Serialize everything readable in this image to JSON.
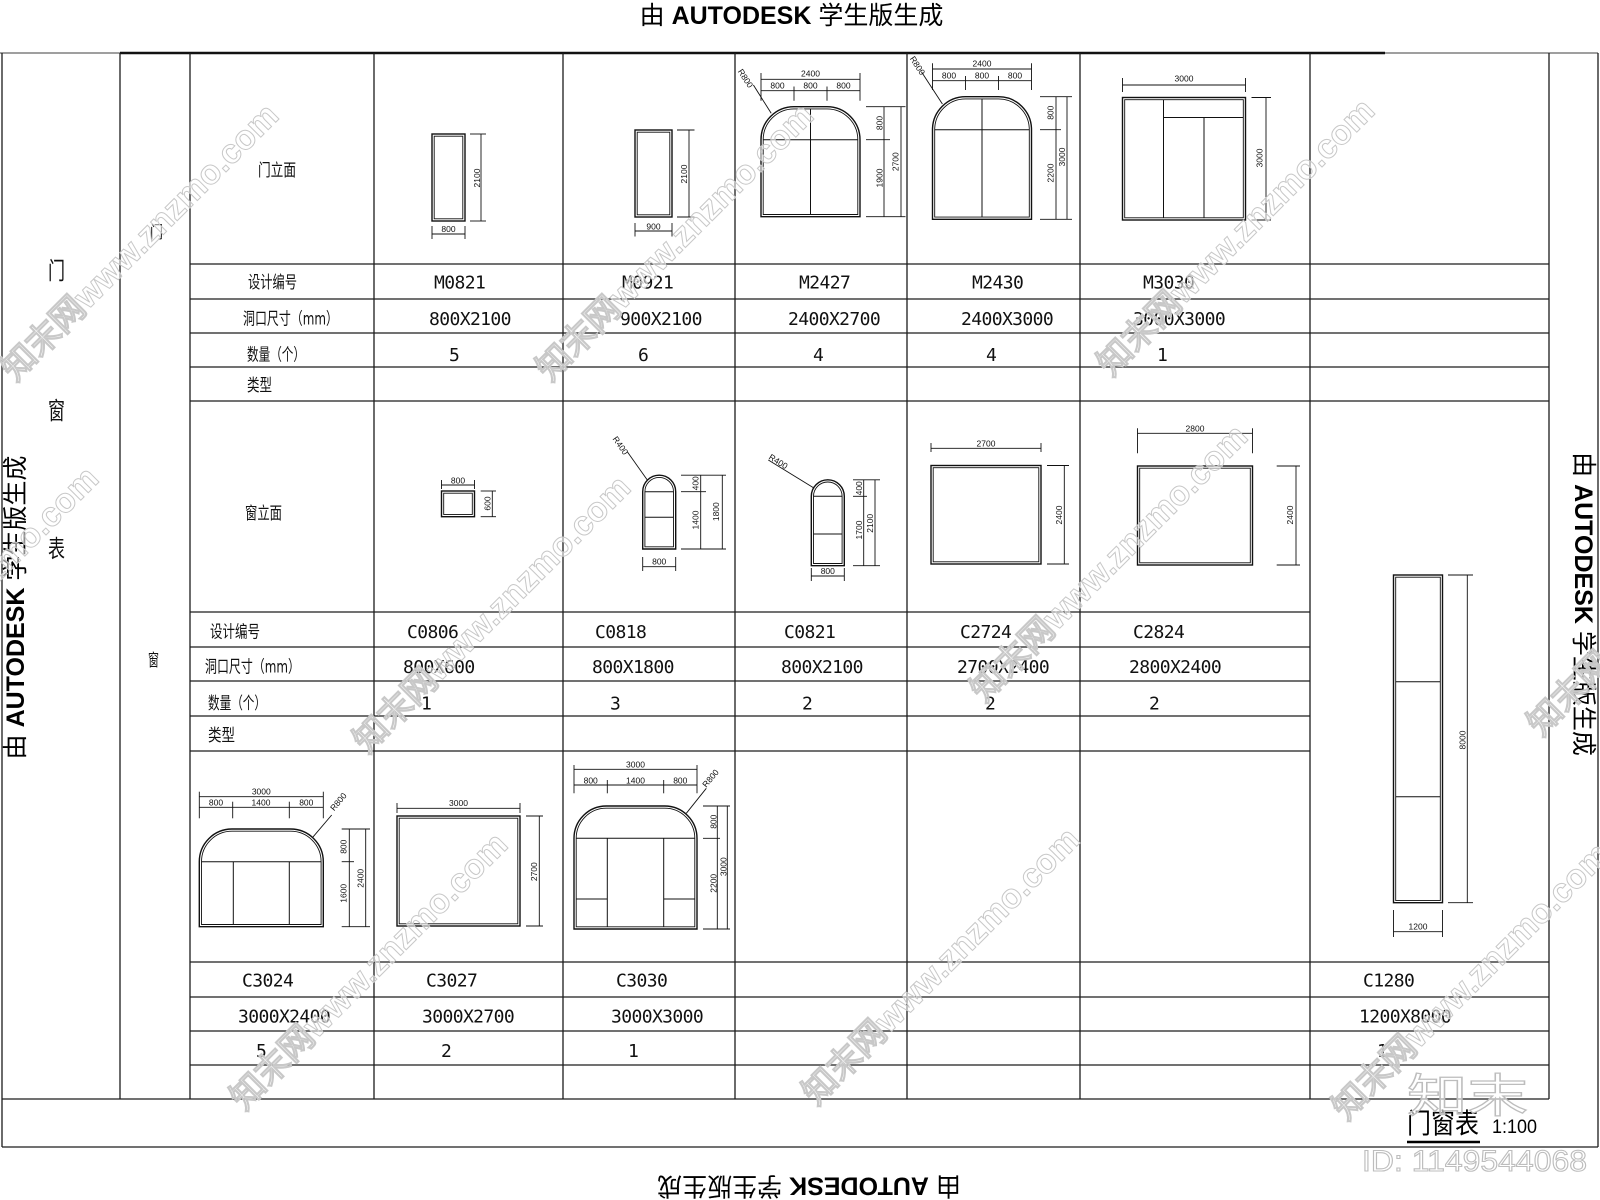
{
  "stamp": {
    "prefix": "由",
    "brand": "AUTODESK",
    "suffix": "学生版生成"
  },
  "sheet": {
    "side_title": [
      "门",
      "窗",
      "表"
    ],
    "section_door": "门",
    "section_window": "窗",
    "title": "门窗表",
    "scale": "1:100"
  },
  "labels": {
    "door_elevation": "门立面",
    "window_elevation": "窗立面",
    "code": "设计编号",
    "size": "洞口尺寸（mm）",
    "quantity": "数量（个）",
    "type": "类型"
  },
  "doors": [
    {
      "code": "M0821",
      "size": "800X2100",
      "quantity": "5",
      "type": "",
      "dims": {
        "width": "800",
        "height": "2100"
      }
    },
    {
      "code": "M0921",
      "size": "900X2100",
      "quantity": "6",
      "type": "",
      "dims": {
        "width": "900",
        "height": "2100"
      }
    },
    {
      "code": "M2427",
      "size": "2400X2700",
      "quantity": "4",
      "type": "",
      "dims": {
        "radius": "R800",
        "total_width": "2400",
        "segments": [
          "800",
          "800",
          "800"
        ],
        "arch_height": "800",
        "lower_height": "1900",
        "total_height": "2700"
      }
    },
    {
      "code": "M2430",
      "size": "2400X3000",
      "quantity": "4",
      "type": "",
      "dims": {
        "radius": "R800",
        "total_width": "2400",
        "segments": [
          "800",
          "800",
          "800"
        ],
        "arch_height": "800",
        "lower_height": "2200",
        "total_height": "3000"
      }
    },
    {
      "code": "M3030",
      "size": "3000X3000",
      "quantity": "1",
      "type": "",
      "dims": {
        "width": "3000",
        "height": "3000"
      }
    }
  ],
  "windows": [
    {
      "code": "C0806",
      "size": "800X600",
      "quantity": "1",
      "type": "",
      "dims": {
        "width": "800",
        "height": "600"
      }
    },
    {
      "code": "C0818",
      "size": "800X1800",
      "quantity": "3",
      "type": "",
      "dims": {
        "radius": "R400",
        "width": "800",
        "arch_height": "400",
        "lower_height": "1400",
        "total_height": "1800"
      }
    },
    {
      "code": "C0821",
      "size": "800X2100",
      "quantity": "2",
      "type": "",
      "dims": {
        "radius": "R400",
        "width": "800",
        "arch_height": "400",
        "lower_height": "1700",
        "total_height": "2100"
      }
    },
    {
      "code": "C2724",
      "size": "2700X2400",
      "quantity": "2",
      "type": "",
      "dims": {
        "width": "2700",
        "height": "2400"
      }
    },
    {
      "code": "C2824",
      "size": "2800X2400",
      "quantity": "2",
      "type": "",
      "dims": {
        "width": "2800",
        "height": "2400"
      }
    },
    {
      "code": "C3024",
      "size": "3000X2400",
      "quantity": "5",
      "type": "",
      "dims": {
        "radius": "R800",
        "total_width": "3000",
        "segments": [
          "800",
          "1400",
          "800"
        ],
        "arch_height": "800",
        "lower_height": "1600",
        "total_height": "2400"
      }
    },
    {
      "code": "C3027",
      "size": "3000X2700",
      "quantity": "2",
      "type": "",
      "dims": {
        "width": "3000",
        "height": "2700"
      }
    },
    {
      "code": "C3030",
      "size": "3000X3000",
      "quantity": "1",
      "type": "",
      "dims": {
        "radius": "R800",
        "total_width": "3000",
        "segments": [
          "800",
          "1400",
          "800"
        ],
        "arch_height": "800",
        "lower_height": "2200",
        "total_height": "3000"
      }
    },
    {
      "code": "C1280",
      "size": "1200X8000",
      "quantity": "1",
      "type": "",
      "dims": {
        "width": "1200",
        "height": "8000"
      }
    }
  ],
  "watermark": {
    "site": "知末网www.znzmo.com",
    "logo": "知末",
    "id": "ID: 1149544068"
  }
}
